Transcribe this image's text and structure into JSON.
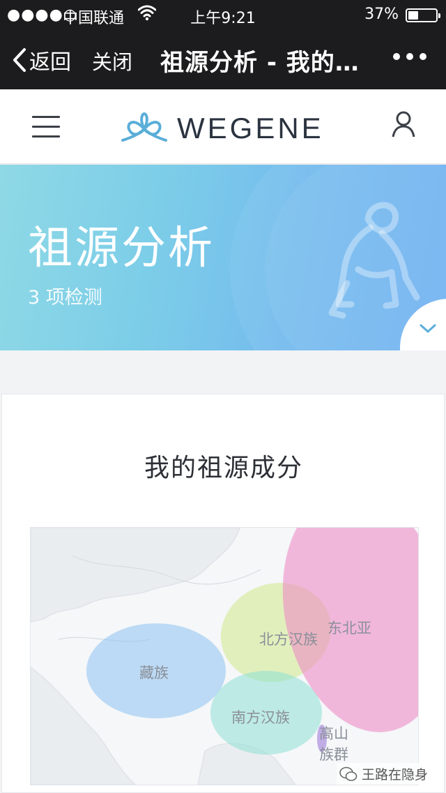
{
  "status_bar": {
    "signal": "●●●●○",
    "carrier": "中国联通",
    "time": "上午9:21",
    "battery_percent": "37%",
    "battery_level": 0.37
  },
  "nav": {
    "back_label": "返回",
    "close_label": "关闭",
    "title": "祖源分析 - 我的…"
  },
  "header": {
    "logo_text": "WEGENE"
  },
  "hero": {
    "title": "祖源分析",
    "subtitle": "3 项检测"
  },
  "card": {
    "title": "我的祖源成分",
    "regions": [
      {
        "label": "藏族",
        "color": "#8cc3f2"
      },
      {
        "label": "北方汉族",
        "color": "#cfe98a"
      },
      {
        "label": "东北亚",
        "color": "#ef8cc6"
      },
      {
        "label": "南方汉族",
        "color": "#8ee0d4"
      },
      {
        "label": "高山\n族群",
        "color": "#b49ae0"
      }
    ]
  },
  "watermark": {
    "text": "王路在隐身"
  },
  "colors": {
    "bar_bg": "#1c1c1e",
    "hero_start": "#8fd9e6",
    "hero_end": "#6cb0f2",
    "accent": "#5aaed8"
  }
}
